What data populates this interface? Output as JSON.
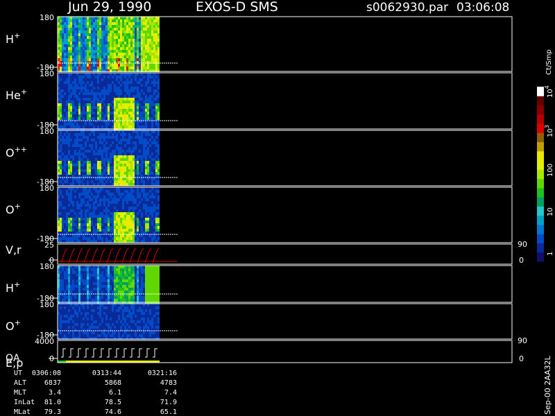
{
  "header": {
    "date": "Jun 29, 1990",
    "instrument": "EXOS-D SMS",
    "file": "s0062930.par",
    "time": "03:06:08"
  },
  "colorbar": {
    "unit": "Ct/Smp",
    "ticks": [
      "1",
      "10",
      "100",
      "10",
      "10"
    ],
    "tick_exponents": [
      "",
      "",
      "",
      "3",
      "4"
    ],
    "tick_values": [
      1,
      10,
      100,
      1000,
      10000
    ],
    "colors": [
      "#10106a",
      "#0a2a9a",
      "#004cc8",
      "#0078d0",
      "#00a0c8",
      "#20c8c8",
      "#00a060",
      "#20c020",
      "#60d800",
      "#a8e800",
      "#e0f000",
      "#e8e800",
      "#c0a000",
      "#906000",
      "#e00000",
      "#b80000",
      "#880000",
      "#600000",
      "#ffffff"
    ]
  },
  "panels": [
    {
      "label": "H",
      "sup": "+",
      "ymax": "180",
      "ymin": "-180"
    },
    {
      "label": "He",
      "sup": "+",
      "ymax": "180",
      "ymin": "-180"
    },
    {
      "label": "O",
      "sup": "++",
      "ymax": "180",
      "ymin": "-180"
    },
    {
      "label": "O",
      "sup": "+",
      "ymax": "180",
      "ymin": "-180"
    },
    {
      "label": "V,r",
      "sup": "",
      "ymax": "25",
      "ymin": "0",
      "right_top": "90",
      "right_bottom": "0"
    },
    {
      "label": "H",
      "sup": "+",
      "ymax": "180",
      "ymin": "-180"
    },
    {
      "label": "O",
      "sup": "+",
      "ymax": "180",
      "ymin": "-180"
    },
    {
      "label": "E,p",
      "label2": "QA",
      "sup": "",
      "ymax": "4000",
      "ymin": "0",
      "right_top": "90",
      "right_bottom": "0"
    }
  ],
  "orbit": {
    "rows": [
      {
        "name": "UT",
        "values": [
          "0306:08",
          "0313:44",
          "0321:16"
        ]
      },
      {
        "name": "ALT",
        "values": [
          "6837",
          "5868",
          "4783"
        ]
      },
      {
        "name": "MLT",
        "values": [
          "3.4",
          "6.1",
          "7.4"
        ]
      },
      {
        "name": "InLat",
        "values": [
          "81.0",
          "78.5",
          "71.9"
        ]
      },
      {
        "name": "MLat",
        "values": [
          "79.3",
          "74.6",
          "65.1"
        ]
      }
    ]
  },
  "footer_vertical": "Sep-00  2AA32L",
  "chart_data": {
    "type": "heatmap",
    "title": "Jun 29, 1990   EXOS-D SMS",
    "x": [
      "0306:08",
      "0313:44",
      "0321:16"
    ],
    "xlabel": "UT",
    "ylabel": "",
    "ylim": [
      -180,
      180
    ],
    "zlabel": "Ct/Smp",
    "zscale": "log",
    "zlim": [
      1,
      10000
    ],
    "series": [
      {
        "name": "H+"
      },
      {
        "name": "He+"
      },
      {
        "name": "O++"
      },
      {
        "name": "O+"
      },
      {
        "name": "V,r",
        "ylim": [
          0,
          25
        ]
      },
      {
        "name": "H+"
      },
      {
        "name": "O+"
      },
      {
        "name": "E,p",
        "ylim": [
          0,
          4000
        ]
      }
    ]
  }
}
